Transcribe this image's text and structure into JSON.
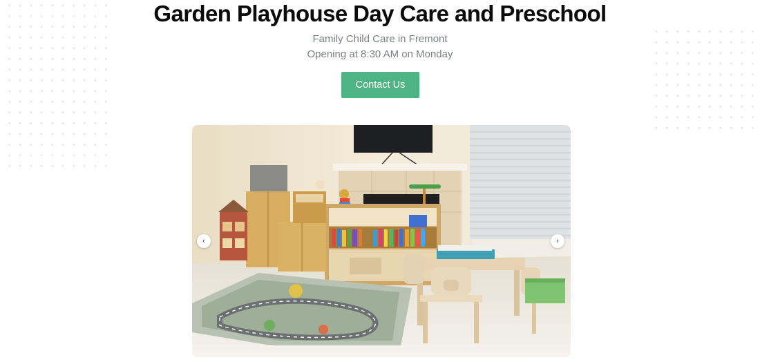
{
  "header": {
    "title": "Garden Playhouse Day Care and Preschool",
    "subtitle": "Family Child Care in Fremont",
    "hours": "Opening at 8:30 AM on Monday"
  },
  "cta": {
    "contact_label": "Contact Us"
  },
  "carousel": {
    "prev_icon": "chevron-left-icon",
    "next_icon": "chevron-right-icon",
    "prev_glyph": "‹",
    "next_glyph": "›"
  },
  "colors": {
    "accent": "#4fb483",
    "title": "#0b0b0b",
    "subtitle": "#7b7f86"
  }
}
